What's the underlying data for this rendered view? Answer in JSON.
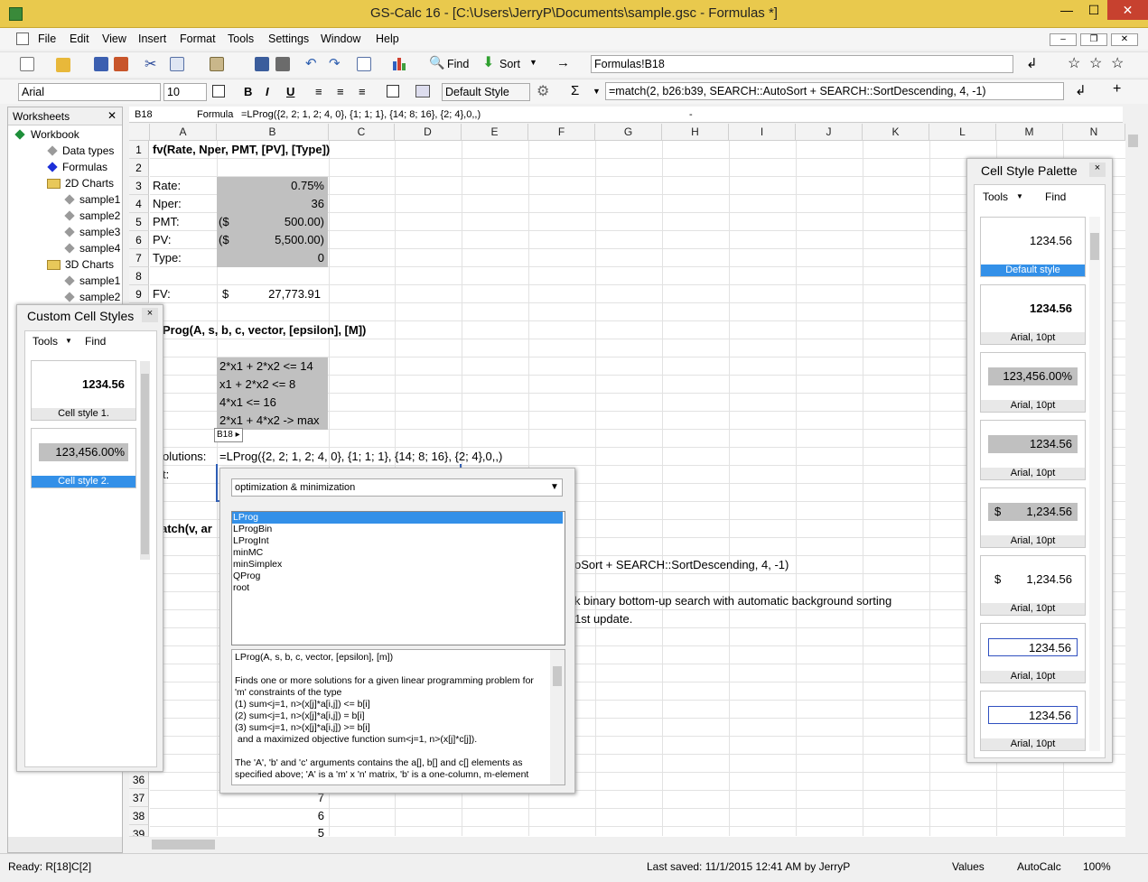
{
  "window": {
    "title": "GS-Calc 16 - [C:\\Users\\JerryP\\Documents\\sample.gsc - Formulas *]",
    "minimize": "—",
    "maximize": "☐",
    "close": "✕"
  },
  "menu": [
    "File",
    "Edit",
    "View",
    "Insert",
    "Format",
    "Tools",
    "Settings",
    "Window",
    "Help"
  ],
  "toolbar": {
    "find": "Find",
    "sort": "Sort",
    "cell_ref": "Formulas!B18",
    "font": "Arial",
    "size": "10",
    "style": "Default Style",
    "formula": "=match(2, b26:b39, SEARCH::AutoSort + SEARCH::SortDescending, 4, -1)"
  },
  "formulabar": {
    "cell": "B18",
    "label": "Formula",
    "text": "=LProg({2, 2; 1, 2; 4, 0}, {1; 1; 1}, {14; 8; 16}, {2; 4},0,,)",
    "dash": "-"
  },
  "worksheets": {
    "title": "Worksheets",
    "close": "✕",
    "items": [
      {
        "label": "Workbook",
        "indent": 0
      },
      {
        "label": "Data types",
        "indent": 1
      },
      {
        "label": "Formulas",
        "indent": 1
      },
      {
        "label": "2D Charts",
        "indent": 1
      },
      {
        "label": "sample1",
        "indent": 2
      },
      {
        "label": "sample2",
        "indent": 2
      },
      {
        "label": "sample3",
        "indent": 2
      },
      {
        "label": "sample4",
        "indent": 2
      },
      {
        "label": "3D Charts",
        "indent": 1
      },
      {
        "label": "sample1",
        "indent": 2
      },
      {
        "label": "sample2",
        "indent": 2
      }
    ]
  },
  "custom_styles": {
    "title": "Custom Cell Styles",
    "close": "×",
    "tools": "Tools",
    "find": "Find",
    "items": [
      {
        "value": "1234.56",
        "label": "Cell style 1."
      },
      {
        "value": "123,456.00%",
        "label": "Cell style 2."
      }
    ]
  },
  "columns": [
    "A",
    "B",
    "C",
    "D",
    "E",
    "F",
    "G",
    "H",
    "I",
    "J",
    "K",
    "L",
    "M",
    "N"
  ],
  "rows": [
    "1",
    "2",
    "3",
    "4",
    "5",
    "6",
    "7",
    "8",
    "9"
  ],
  "rows_bottom": [
    "36",
    "37",
    "38",
    "39"
  ],
  "cells": {
    "r1": "fv(Rate, Nper, PMT, [PV], [Type])",
    "rate": "Rate:",
    "rate_v": "0.75%",
    "nper": "Nper:",
    "nper_v": "36",
    "pmt": "PMT:",
    "pmt_p": "($",
    "pmt_v": "500.00)",
    "pv": "PV:",
    "pv_p": "($",
    "pv_v": "5,500.00)",
    "type": "Type:",
    "type_v": "0",
    "fv": "FV:",
    "fv_p": "$",
    "fv_v": "27,773.91",
    "lprog": "Prog(A, s, b, c, vector, [epsilon], [M])",
    "c1": "2*x1 + 2*x2 <= 14",
    "c2": "x1 + 2*x2 <= 8",
    "c3": "4*x1 <= 16",
    "c4": "2*x1 + 4*x2 -> max",
    "tag": "B18 ▸",
    "sol": "olutions:",
    "sol_f": "=LProg({2, 2; 1, 2; 4, 0}, {1; 1; 1}, {14; 8; 16}, {2; 4},0,,)",
    "t": "t:",
    "match": "atch(v, ar",
    "m_rest": "oSort + SEARCH::SortDescending, 4, -1)",
    "bin": "k binary bottom-up search with automatic background sorting",
    "upd": "1st update.",
    "b37": "7",
    "b38": "6",
    "b39": "5"
  },
  "popup": {
    "category": "optimization & minimization",
    "functions": [
      "LProg",
      "LProgBin",
      "LProgInt",
      "minMC",
      "minSimplex",
      "QProg",
      "root"
    ],
    "desc": [
      "LProg(A, s, b, c, vector, [epsilon], [m])",
      "",
      "Finds one or more solutions for a given linear programming problem for",
      "'m' constraints of the type",
      "(1) sum<j=1, n>(x[j]*a[i,j]) <= b[i]",
      "(2) sum<j=1, n>(x[j]*a[i,j]) = b[i]",
      "(3) sum<j=1, n>(x[j]*a[i,j]) >= b[i]",
      " and a maximized objective function sum<j=1, n>(x[j]*c[j]).",
      "",
      "The 'A', 'b' and 'c' arguments contains the a[], b[] and c[] elements as",
      "specified above; 'A' is a 'm' x 'n' matrix, 'b' is a one-column, m-element"
    ]
  },
  "palette": {
    "title": "Cell Style Palette",
    "close": "×",
    "tools": "Tools",
    "find": "Find",
    "items": [
      {
        "value": "1234.56",
        "label": "Default style"
      },
      {
        "value": "1234.56",
        "label": "Arial, 10pt"
      },
      {
        "value": "123,456.00%",
        "label": "Arial, 10pt"
      },
      {
        "value": "1234.56",
        "label": "Arial, 10pt"
      },
      {
        "prefix": "$",
        "value": "1,234.56",
        "label": "Arial, 10pt"
      },
      {
        "prefix": "$",
        "value": "1,234.56",
        "label": "Arial, 10pt"
      },
      {
        "value": "1234.56",
        "label": "Arial, 10pt"
      },
      {
        "value": "1234.56",
        "label": "Arial, 10pt"
      }
    ]
  },
  "status": {
    "ready": "Ready:  R[18]C[2]",
    "saved": "Last saved:  11/1/2015 12:41 AM  by  JerryP",
    "values": "Values",
    "autocalc": "AutoCalc",
    "zoom": "100%"
  }
}
